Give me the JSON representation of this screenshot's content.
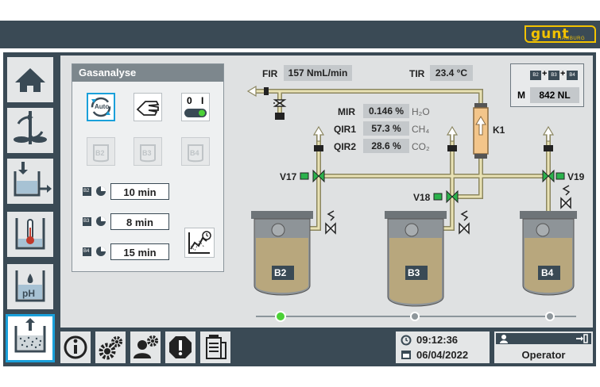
{
  "brand": {
    "logo_text": "gunt",
    "logo_sub": "HAMBURG"
  },
  "panel": {
    "title": "Gasanalyse",
    "auto_label": "Auto",
    "switch_labels": [
      "0",
      "I"
    ],
    "tank_buttons": [
      "B2",
      "B3",
      "B4"
    ],
    "timers": [
      {
        "tank": "B2",
        "value": "10 min"
      },
      {
        "tank": "B3",
        "value": "8 min"
      },
      {
        "tank": "B4",
        "value": "15 min"
      }
    ]
  },
  "readings": {
    "fir": {
      "tag": "FIR",
      "value": "157 NmL/min"
    },
    "tir": {
      "tag": "TIR",
      "value": "23.4 °C"
    },
    "mir": {
      "tag": "MIR",
      "value": "0.146 %",
      "unit": "H₂O"
    },
    "qir1": {
      "tag": "QIR1",
      "value": "57.3 %",
      "unit": "CH₄"
    },
    "qir2": {
      "tag": "QIR2",
      "value": "28.6 %",
      "unit": "CO₂"
    }
  },
  "m_box": {
    "tags": [
      "B2",
      "B3",
      "B4"
    ],
    "plus": "+",
    "label": "M",
    "value": "842 NL"
  },
  "valves": [
    "V17",
    "V18",
    "V19"
  ],
  "column": "K1",
  "tanks": [
    "B2",
    "B3",
    "B4"
  ],
  "indicator_colors": {
    "active": "#4cd137",
    "inactive": "#8e969b"
  },
  "status": {
    "time": "09:12:36",
    "date": "06/04/2022",
    "user": "Operator"
  },
  "colors": {
    "dark": "#3a4a55",
    "accent": "#1aa0da",
    "pipe": "#e9e2b4",
    "pipe_outline": "#8b8660",
    "green": "#2bb24c"
  }
}
